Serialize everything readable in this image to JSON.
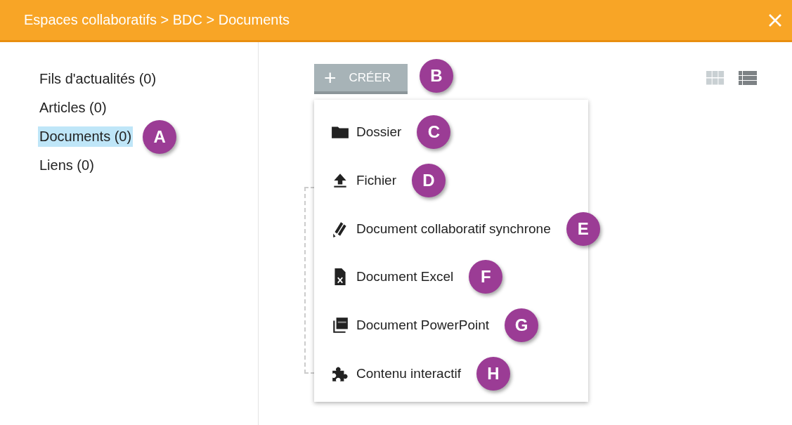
{
  "window": {
    "title": "Espaces collaboratifs > BDC > Documents"
  },
  "sidebar": {
    "items": [
      {
        "label": "Fils d'actualités (0)",
        "selected": false
      },
      {
        "label": "Articles (0)",
        "selected": false
      },
      {
        "label": "Documents (0)",
        "selected": true,
        "callout": "A"
      },
      {
        "label": "Liens (0)",
        "selected": false
      }
    ]
  },
  "create_button": {
    "icon": "+",
    "label": "CRÉER",
    "callout": "B"
  },
  "view_toggles": [
    {
      "kind": "grid",
      "selected": false
    },
    {
      "kind": "list",
      "selected": true
    }
  ],
  "create_menu": {
    "items": [
      {
        "kind": "folder",
        "label": "Dossier",
        "callout": "C"
      },
      {
        "kind": "upload",
        "label": "Fichier",
        "callout": "D"
      },
      {
        "kind": "pencils",
        "label": "Document collaboratif synchrone",
        "callout": "E"
      },
      {
        "kind": "excel",
        "label": "Document Excel",
        "callout": "F"
      },
      {
        "kind": "powerpoint",
        "label": "Document PowerPoint",
        "callout": "G"
      },
      {
        "kind": "puzzle",
        "label": "Contenu interactif",
        "callout": "H"
      }
    ]
  }
}
